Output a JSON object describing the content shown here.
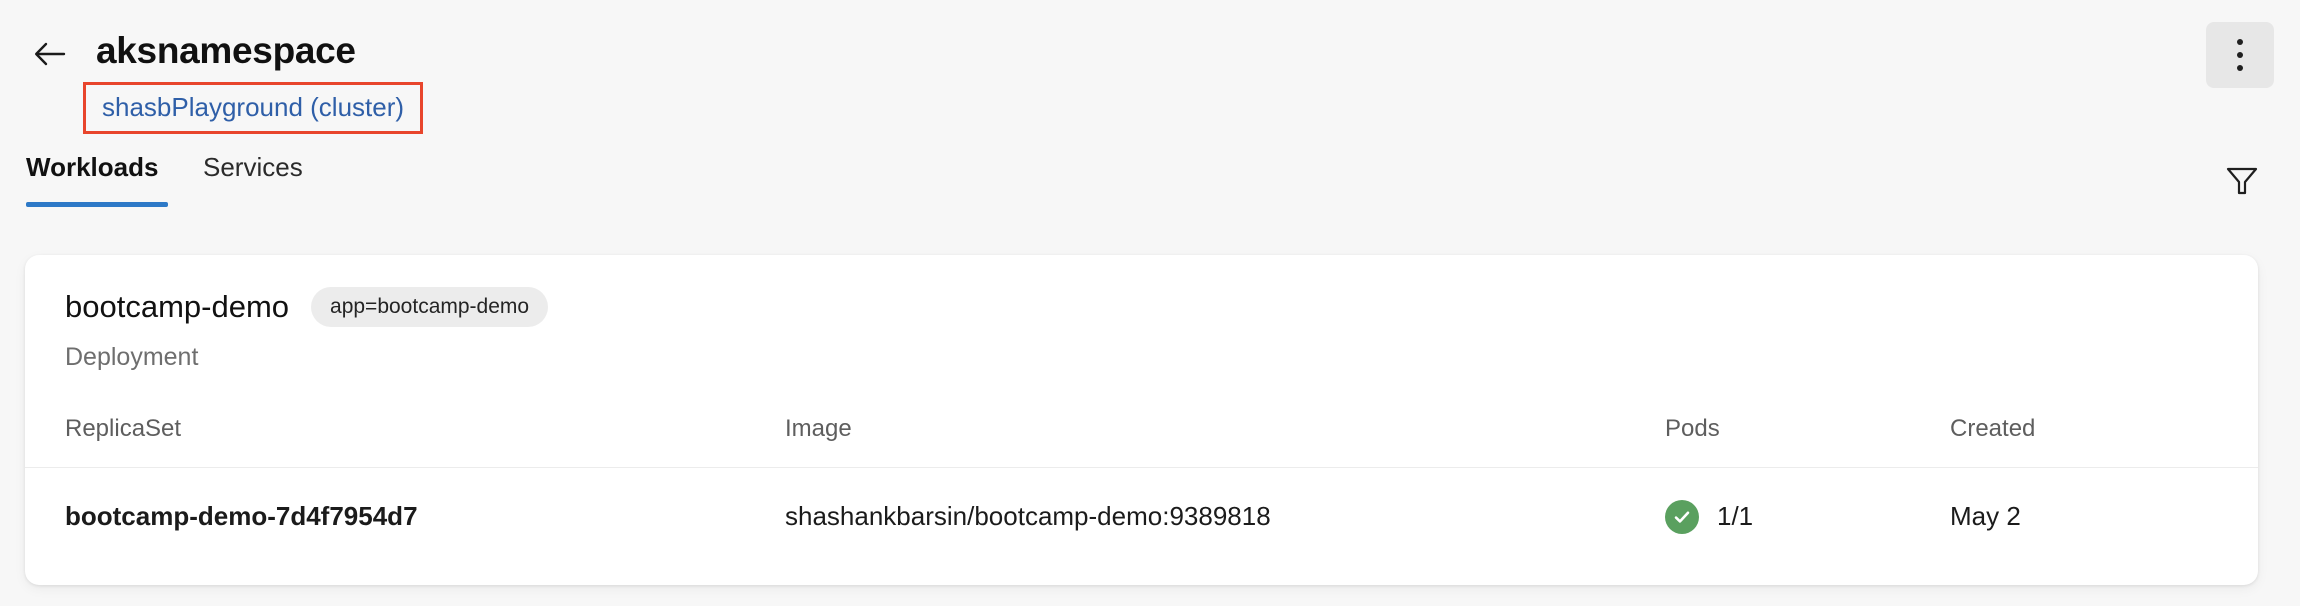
{
  "header": {
    "back_icon": "arrow-left-icon",
    "title": "aksnamespace",
    "cluster_link": "shasbPlayground (cluster)",
    "menu_icon": "kebab-menu-icon",
    "annotation_color": "#e8452c",
    "link_color": "#2f5fa8"
  },
  "tabs": {
    "items": [
      {
        "label": "Workloads",
        "active": true
      },
      {
        "label": "Services",
        "active": false
      }
    ],
    "active_color": "#2d79c7",
    "filter_icon": "filter-funnel-icon"
  },
  "workload": {
    "name": "bootcamp-demo",
    "label_chip": "app=bootcamp-demo",
    "kind": "Deployment"
  },
  "table": {
    "columns": [
      "ReplicaSet",
      "Image",
      "Pods",
      "Created"
    ],
    "rows": [
      {
        "replicaset": "bootcamp-demo-7d4f7954d7",
        "image": "shashankbarsin/bootcamp-demo:9389818",
        "pods": "1/1",
        "pods_status_icon": "check-circle-icon",
        "pods_status_color": "#5aa05f",
        "created": "May 2"
      }
    ]
  }
}
